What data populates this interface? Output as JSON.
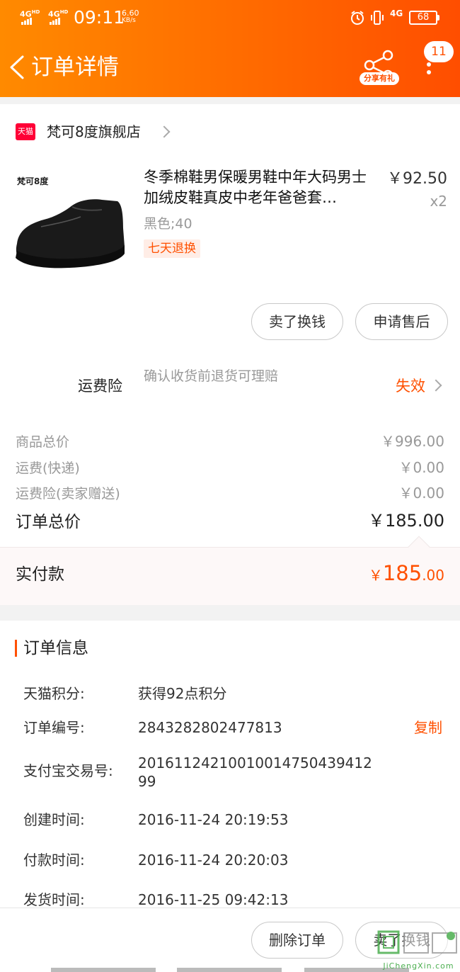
{
  "status_bar": {
    "network1": "4G",
    "network1_sub": "HD",
    "network2": "4G",
    "network2_sub": "HD",
    "time": "09:11",
    "speed_value": "6.60",
    "speed_unit": "KB/s",
    "right_network": "4G",
    "battery": "68",
    "icons": [
      "alarm-icon",
      "vibrate-icon",
      "signal-4g-icon",
      "battery-icon"
    ]
  },
  "header": {
    "title": "订单详情",
    "share_label": "分享有礼",
    "badge_count": "11"
  },
  "store": {
    "platform_badge": "天猫",
    "name": "梵可8度旗舰店"
  },
  "product": {
    "brand_mark": "梵可8度",
    "title": "冬季棉鞋男保暖男鞋中年大码男士加绒皮鞋真皮中老年爸爸套…",
    "price": "￥92.50",
    "quantity": "x2",
    "sku": "黑色;40",
    "tag": "七天退换",
    "buttons": [
      "卖了换钱",
      "申请售后"
    ]
  },
  "insurance": {
    "label": "运费险",
    "description": "确认收货前退货可理赔",
    "status": "失效"
  },
  "price_rows": [
    {
      "label": "商品总价",
      "value": "￥996.00"
    },
    {
      "label": "运费(快递)",
      "value": "￥0.00"
    },
    {
      "label": "运费险(卖家赠送)",
      "value": "￥0.00"
    }
  ],
  "order_total": {
    "label": "订单总价",
    "value": "￥185.00"
  },
  "actual_paid": {
    "label": "实付款",
    "currency": "￥",
    "integer": "185",
    "decimal": ".00"
  },
  "order_info": {
    "title": "订单信息",
    "rows": [
      {
        "key": "天猫积分:",
        "value": "获得92点积分"
      },
      {
        "key": "订单编号:",
        "value": "2843282802477813"
      },
      {
        "key": "支付宝交易号:",
        "value": "2016112421001001475043941299"
      },
      {
        "key": "创建时间:",
        "value": "2016-11-24 20:19:53"
      },
      {
        "key": "付款时间:",
        "value": "2016-11-24 20:20:03"
      },
      {
        "key": "发货时间:",
        "value": "2016-11-25 09:42:13"
      }
    ],
    "copy_label": "复制"
  },
  "bottom_bar": {
    "buttons": [
      "删除订单",
      "卖了换钱"
    ]
  },
  "watermark": {
    "text": "JiChengXin.com"
  },
  "colors": {
    "header_start": "#ff8a00",
    "header_end": "#ff4e00",
    "accent": "#ff5000",
    "tmall_red": "#ff0036"
  }
}
